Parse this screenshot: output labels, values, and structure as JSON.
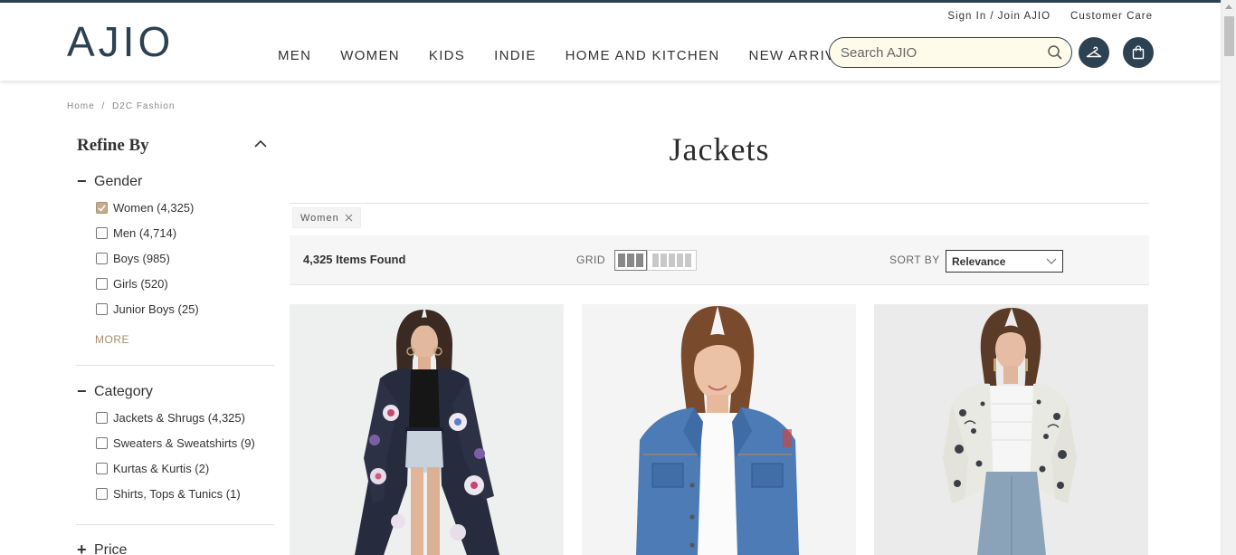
{
  "header": {
    "logo": "AJIO",
    "top_links": [
      "Sign In / Join AJIO",
      "Customer Care"
    ],
    "nav": [
      "MEN",
      "WOMEN",
      "KIDS",
      "INDIE",
      "HOME AND KITCHEN",
      "NEW ARRIVALS"
    ],
    "search_placeholder": "Search AJIO"
  },
  "breadcrumb": [
    "Home",
    "/",
    "D2C Fashion"
  ],
  "sidebar": {
    "title": "Refine By",
    "sections": [
      {
        "label": "Gender",
        "expanded_symbol": "−",
        "items": [
          {
            "label": "Women (4,325)",
            "checked": true
          },
          {
            "label": "Men (4,714)",
            "checked": false
          },
          {
            "label": "Boys (985)",
            "checked": false
          },
          {
            "label": "Girls (520)",
            "checked": false
          },
          {
            "label": "Junior Boys (25)",
            "checked": false
          }
        ],
        "more_label": "MORE"
      },
      {
        "label": "Category",
        "expanded_symbol": "−",
        "items": [
          {
            "label": "Jackets & Shrugs (4,325)",
            "checked": false
          },
          {
            "label": "Sweaters & Sweatshirts (9)",
            "checked": false
          },
          {
            "label": "Kurtas & Kurtis (2)",
            "checked": false
          },
          {
            "label": "Shirts, Tops & Tunics (1)",
            "checked": false
          }
        ]
      },
      {
        "label": "Price",
        "expanded_symbol": "+"
      }
    ]
  },
  "main": {
    "title": "Jackets",
    "active_filter": "Women",
    "items_found": "4,325 Items Found",
    "grid_label": "GRID",
    "sort_label": "SORT BY",
    "sort_value": "Relevance"
  },
  "colors": {
    "brand": "#2c4152",
    "accent_gold": "#a58e6a",
    "search_bg": "#fffbea"
  }
}
